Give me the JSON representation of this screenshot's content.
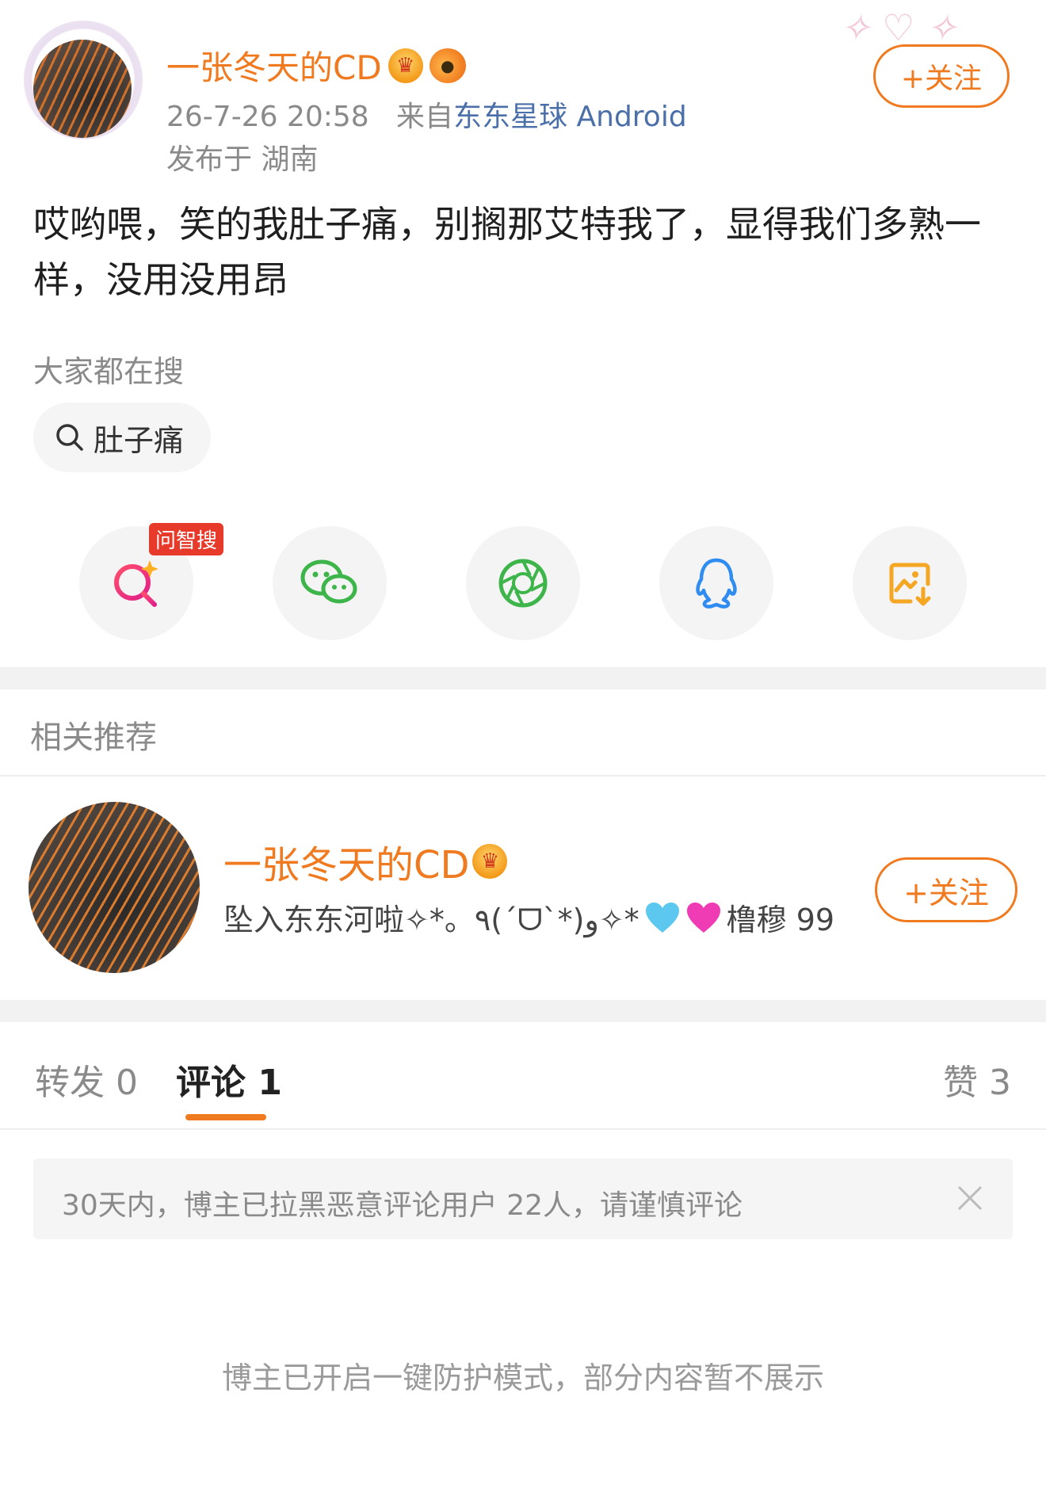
{
  "header": {
    "username": "一张冬天的CD",
    "timestamp": "26-7-26 20:58",
    "source_prefix": "来自",
    "source_name": "东东星球 Android",
    "location": "发布于 湖南",
    "follow_label": "+关注",
    "badges": [
      "crown-badge-icon",
      "fish-badge-icon"
    ]
  },
  "post": {
    "text": "哎哟喂，笑的我肚子痛，别搁那艾特我了，显得我们多熟一样，没用没用昂"
  },
  "trending": {
    "label": "大家都在搜",
    "chip": "肚子痛"
  },
  "share": {
    "tag": "问智搜",
    "items": [
      "ai-search-icon",
      "wechat-icon",
      "moments-icon",
      "qq-icon",
      "save-image-icon"
    ]
  },
  "related": {
    "title": "相关推荐",
    "user": {
      "name": "一张冬天的CD",
      "desc_prefix": "坠入东东河啦✧*。٩(ˊᗜˋ*)و✧*",
      "desc_suffix": "橹穆 99",
      "follow_label": "+关注"
    }
  },
  "tabs": {
    "repost": "转发 0",
    "comment": "评论 1",
    "like": "赞 3"
  },
  "notice": {
    "text": "30天内，博主已拉黑恶意评论用户 22人，请谨慎评论"
  },
  "footer": {
    "text": "博主已开启一键防护模式，部分内容暂不展示"
  },
  "colors": {
    "accent": "#f07a1f",
    "link": "#4b6fa8",
    "muted": "#8a8a8a"
  }
}
